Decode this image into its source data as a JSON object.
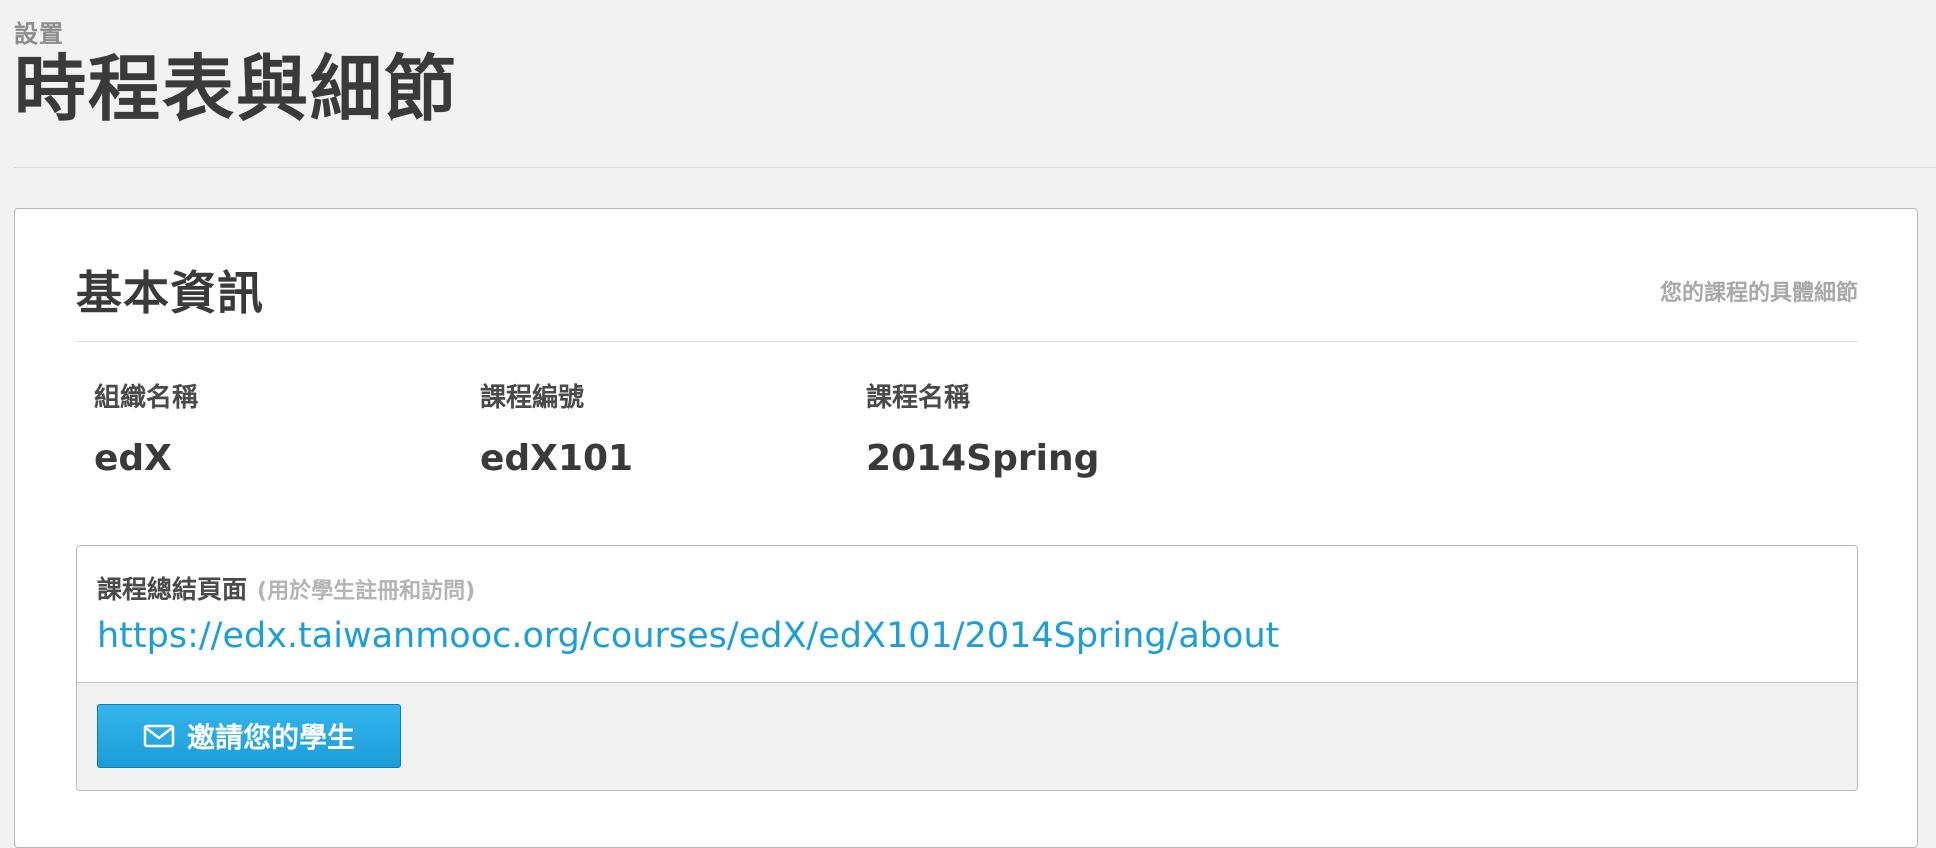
{
  "page": {
    "subtitle": "設置",
    "title": "時程表與細節"
  },
  "section": {
    "title": "基本資訊",
    "description": "您的課程的具體細節"
  },
  "fields": [
    {
      "label": "組織名稱",
      "value": "edX"
    },
    {
      "label": "課程編號",
      "value": "edX101"
    },
    {
      "label": "課程名稱",
      "value": "2014Spring"
    }
  ],
  "summary": {
    "label": "課程總結頁面",
    "note": "(用於學生註冊和訪問)",
    "url": "https://edx.taiwanmooc.org/courses/edX/edX101/2014Spring/about"
  },
  "invite_button": {
    "label": "邀請您的學生",
    "icon": "envelope-icon"
  },
  "colors": {
    "accent": "#1b9ed9",
    "button": "#1a9cd8",
    "background": "#f2f2f2"
  }
}
